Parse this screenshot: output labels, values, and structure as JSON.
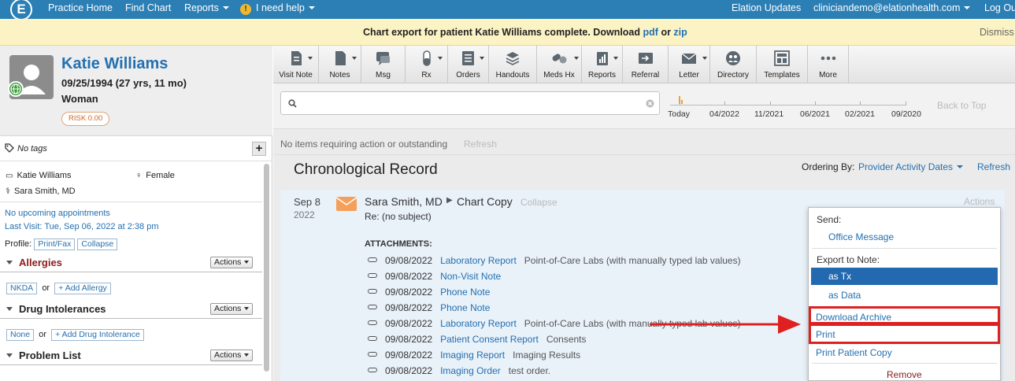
{
  "nav": {
    "logo": "E",
    "practice_home": "Practice Home",
    "find_chart": "Find Chart",
    "reports": "Reports",
    "help_icon": "!",
    "help": "I need help",
    "updates": "Elation Updates",
    "user": "cliniciandemo@elationhealth.com",
    "logout": "Log Ou"
  },
  "banner": {
    "message": "Chart export for patient Katie Williams complete. Download",
    "pdf": "pdf",
    "or": "or",
    "zip": "zip",
    "dismiss": "Dismiss"
  },
  "patient": {
    "name": "Katie Williams",
    "dob": "09/25/1994 (27 yrs, 11 mo)",
    "sex": "Woman",
    "risk": "RISK 0.00",
    "tags": "No tags",
    "plus": "+",
    "chart_name": "Katie Williams",
    "gender": "Female",
    "provider": "Sara Smith, MD",
    "appointments": "No upcoming appointments",
    "last_visit": "Last Visit: Tue, Sep 06, 2022 at 2:38 pm",
    "profile_label": "Profile:",
    "print_fax": "Print/Fax",
    "collapse": "Collapse"
  },
  "sections": {
    "allergies": "Allergies",
    "nkda": "NKDA",
    "or": "or",
    "add_allergy": "+ Add Allergy",
    "drug_intolerances": "Drug Intolerances",
    "none": "None",
    "add_intolerance": "+ Add Drug Intolerance",
    "problem_list": "Problem List",
    "actions": "Actions"
  },
  "toolbar": [
    {
      "label": "Visit Note",
      "icon": "document-icon"
    },
    {
      "label": "Notes",
      "icon": "notes-icon"
    },
    {
      "label": "Msg",
      "icon": "message-icon"
    },
    {
      "label": "Rx",
      "icon": "pill-icon"
    },
    {
      "label": "Orders",
      "icon": "orders-icon"
    },
    {
      "label": "Handouts",
      "icon": "handouts-icon"
    },
    {
      "label": "Meds Hx",
      "icon": "meds-icon"
    },
    {
      "label": "Reports",
      "icon": "reports-icon"
    },
    {
      "label": "Referral",
      "icon": "referral-icon"
    },
    {
      "label": "Letter",
      "icon": "envelope-icon"
    },
    {
      "label": "Directory",
      "icon": "directory-icon"
    },
    {
      "label": "Templates",
      "icon": "templates-icon"
    },
    {
      "label": "More",
      "icon": "more-icon"
    }
  ],
  "search": {
    "placeholder": "",
    "timeline": [
      "Today",
      "04/2022",
      "11/2021",
      "06/2021",
      "02/2021",
      "09/2020"
    ],
    "back_to_top": "Back to Top"
  },
  "main": {
    "no_items": "No items requiring action or outstanding",
    "refresh_gray": "Refresh",
    "title": "Chronological Record",
    "ordering_label": "Ordering By:",
    "ordering_value": "Provider Activity Dates",
    "refresh": "Refresh"
  },
  "record": {
    "date": "Sep 8",
    "year": "2022",
    "author": "Sara Smith, MD",
    "type": "Chart Copy",
    "collapse": "Collapse",
    "subject": "Re: (no subject)",
    "actions": "Actions",
    "attachments_label": "ATTACHMENTS:",
    "attachments": [
      {
        "date": "09/08/2022",
        "name": "Laboratory Report",
        "desc": "Point-of-Care Labs (with manually typed lab values)"
      },
      {
        "date": "09/08/2022",
        "name": "Non-Visit Note",
        "desc": ""
      },
      {
        "date": "09/08/2022",
        "name": "Phone Note",
        "desc": ""
      },
      {
        "date": "09/08/2022",
        "name": "Phone Note",
        "desc": ""
      },
      {
        "date": "09/08/2022",
        "name": "Laboratory Report",
        "desc": "Point-of-Care Labs (with manually typed lab values)"
      },
      {
        "date": "09/08/2022",
        "name": "Patient Consent Report",
        "desc": "Consents"
      },
      {
        "date": "09/08/2022",
        "name": "Imaging Report",
        "desc": "Imaging Results"
      },
      {
        "date": "09/08/2022",
        "name": "Imaging Order",
        "desc": "test order."
      }
    ]
  },
  "dropdown": {
    "send": "Send:",
    "office_message": "Office Message",
    "export": "Export to Note:",
    "as_tx": "as Tx",
    "as_data": "as Data",
    "download_archive": "Download Archive",
    "print": "Print",
    "print_patient_copy": "Print Patient Copy",
    "remove": "Remove"
  },
  "colors": {
    "nav": "#2b7fb5",
    "banner": "#fcf3c4",
    "link": "#2470b0",
    "highlight": "#e02020",
    "selected": "#2369b0"
  }
}
